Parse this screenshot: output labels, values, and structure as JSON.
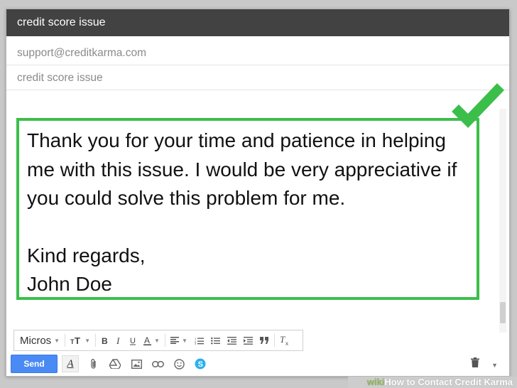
{
  "window": {
    "title": "credit score issue"
  },
  "fields": {
    "to": "support@creditkarma.com",
    "subject": "credit score issue"
  },
  "body": {
    "paragraph": "Thank you for your time and patience in helping me with this issue. I would be very appreciative if you could solve this problem for me.",
    "closing": "Kind regards,",
    "signature": "John Doe"
  },
  "formatting": {
    "font": "Micros"
  },
  "actions": {
    "send_label": "Send"
  },
  "footer": {
    "brand": "wiki",
    "caption": "How to Contact Credit Karma"
  },
  "colors": {
    "highlight_border": "#3bbf4a",
    "checkmark": "#3bbf4a",
    "send_button": "#4a8af4",
    "titlebar": "#424242"
  },
  "icons": [
    "checkmark-icon",
    "text-size-icon",
    "bold-icon",
    "italic-icon",
    "underline-icon",
    "text-color-icon",
    "align-icon",
    "numbered-list-icon",
    "bulleted-list-icon",
    "indent-less-icon",
    "indent-more-icon",
    "quote-icon",
    "remove-formatting-icon",
    "attach-icon",
    "drive-icon",
    "photo-icon",
    "link-icon",
    "emoji-icon",
    "skype-icon",
    "trash-icon",
    "more-options-icon"
  ]
}
